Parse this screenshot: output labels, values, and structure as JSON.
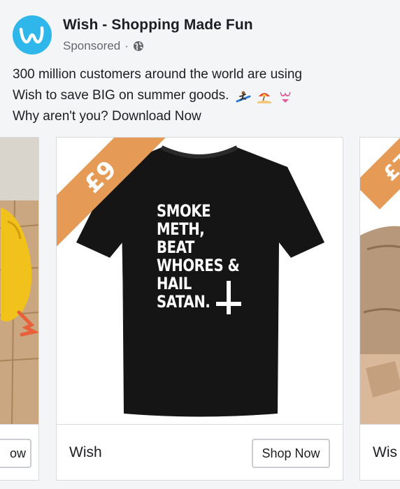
{
  "post": {
    "page_name": "Wish - Shopping Made Fun",
    "sponsored": "Sponsored",
    "separator": "·",
    "text_line1": "300 million customers around the world are using",
    "text_line2": "Wish to save BIG on summer goods.",
    "text_line3": "Why aren't you? Download Now",
    "emojis": [
      "surfer-icon",
      "beach-umbrella-icon",
      "bikini-icon"
    ]
  },
  "carousel": {
    "left_card": {
      "footer_label": "",
      "button_label_partial": "ow"
    },
    "main_card": {
      "price": "£9",
      "shirt_lines": [
        "SMOKE",
        "METH,",
        "BEAT",
        "WHORES &",
        "HAIL",
        "SATAN."
      ],
      "footer_label": "Wish",
      "button_label": "Shop Now"
    },
    "right_card": {
      "price_partial": "£7",
      "footer_label_partial": "Wis"
    }
  },
  "colors": {
    "brand_blue": "#2fb7ec",
    "price_orange": "#e59a56",
    "shirt_black": "#151515",
    "background": "#f4f5f7"
  }
}
